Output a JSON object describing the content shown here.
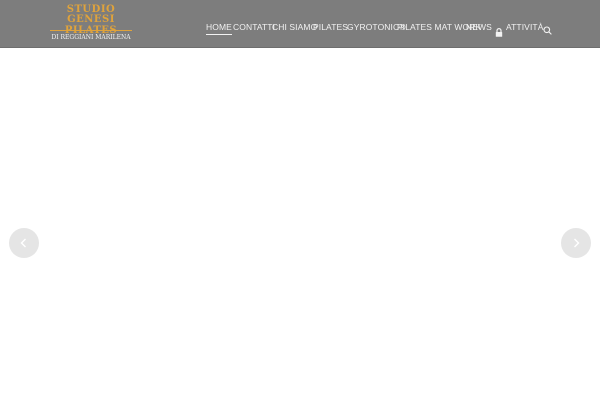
{
  "logo": {
    "line1": "STUDIO GENESI",
    "line2": "PILATES",
    "line3": "DI REGGIANI MARILENA"
  },
  "nav": {
    "items": [
      {
        "label": "HOME"
      },
      {
        "label": "CONTATTI"
      },
      {
        "label": "CHI SIAMO"
      },
      {
        "label": "PILATES"
      },
      {
        "label": "GYROTONIC®"
      },
      {
        "label": "PILATES MAT WORK"
      },
      {
        "label": "NEWS"
      },
      {
        "label": "ATTIVITÀ"
      }
    ],
    "active": "HOME",
    "search_icon": "search-icon",
    "lock_icon": "lock-icon"
  },
  "slider": {
    "prev_icon": "chevron-left-icon",
    "next_icon": "chevron-right-icon"
  },
  "colors": {
    "header_bg": "#7d7d7d",
    "logo_gold": "#e0a33b",
    "nav_text": "#f2f2f2",
    "arrow_bg": "#e5e5e5"
  }
}
